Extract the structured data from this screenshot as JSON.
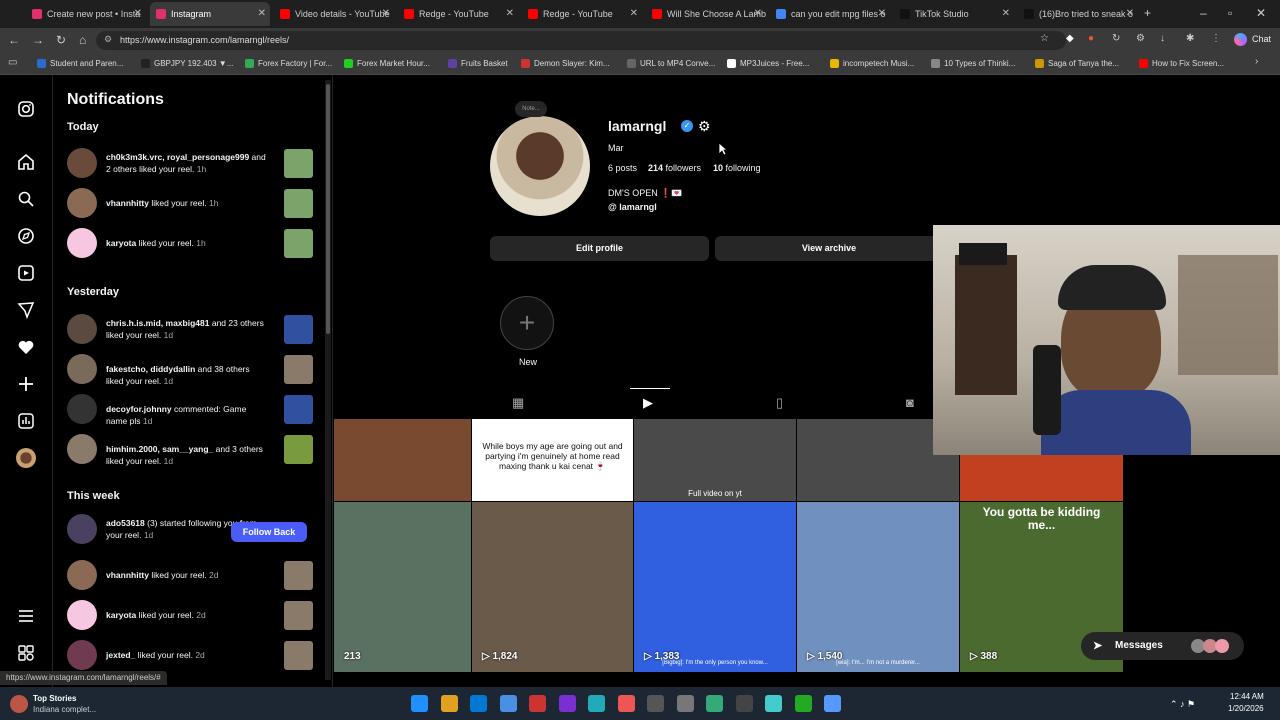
{
  "browser": {
    "tabs": [
      {
        "label": "Create new post • Insta",
        "color": "#e1306c"
      },
      {
        "label": "Instagram",
        "color": "#e1306c",
        "active": true
      },
      {
        "label": "Video details - YouTube",
        "color": "#ff0000"
      },
      {
        "label": "Redge - YouTube",
        "color": "#ff0000"
      },
      {
        "label": "Redge - YouTube",
        "color": "#ff0000"
      },
      {
        "label": "Will She Choose A Lamb",
        "color": "#ff0000"
      },
      {
        "label": "can you edit mpg files o",
        "color": "#4285f4"
      },
      {
        "label": "TikTok Studio",
        "color": "#111111"
      },
      {
        "label": "(16)Bro tried to sneak o",
        "color": "#111111"
      }
    ],
    "url": "https://www.instagram.com/lamarngl/reels/",
    "chat_label": "Chat",
    "bookmarks": [
      {
        "label": "Student and Paren...",
        "color": "#2a6bd1"
      },
      {
        "label": "GBPJPY 192.403 ▼...",
        "color": "#222"
      },
      {
        "label": "Forex Factory | For...",
        "color": "#3a5"
      },
      {
        "label": "Forex Market Hour...",
        "color": "#2c2"
      },
      {
        "label": "Fruits Basket",
        "color": "#6040a0"
      },
      {
        "label": "Demon Slayer: Kim...",
        "color": "#c33"
      },
      {
        "label": "URL to MP4 Conve...",
        "color": "#666"
      },
      {
        "label": "MP3Juices - Free...",
        "color": "#fff"
      },
      {
        "label": "incompetech Musi...",
        "color": "#e6b800"
      },
      {
        "label": "10 Types of Thinki...",
        "color": "#888"
      },
      {
        "label": "Saga of Tanya the...",
        "color": "#c90"
      },
      {
        "label": "How to Fix Screen...",
        "color": "#f00"
      }
    ]
  },
  "rail": {
    "icons": [
      "instagram-icon",
      "home-icon",
      "search-icon",
      "explore-icon",
      "reels-icon",
      "messages-icon",
      "heart-icon",
      "create-icon",
      "dashboard-icon",
      "profile-icon",
      "menu-icon",
      "threads-icon"
    ]
  },
  "notifications": {
    "title": "Notifications",
    "sections": {
      "today": "Today",
      "yesterday": "Yesterday",
      "this_week": "This week"
    },
    "items": [
      {
        "users": "ch0k3m3k.vrc, royal_personage999",
        "text": "and 2 others liked your reel.",
        "time": "1h",
        "avatar": "#6a4a3a",
        "thumb": "#7ca36a"
      },
      {
        "users": "vhannhitty",
        "text": "liked your reel.",
        "time": "1h",
        "avatar": "#8b6a55",
        "thumb": "#7ca36a"
      },
      {
        "users": "karyota",
        "text": "liked your reel.",
        "time": "1h",
        "avatar": "#f7c6e0",
        "thumb": "#7ca36a"
      },
      {
        "users": "chris.h.is.mid, maxbig481",
        "text": "and 23 others liked your reel.",
        "time": "1d",
        "avatar": "#5a4a40",
        "thumb": "#3050a0"
      },
      {
        "users": "fakestcho, diddydallin",
        "text": "and 38 others liked your reel.",
        "time": "1d",
        "avatar": "#7a6a5a",
        "thumb": "#8a7a6a"
      },
      {
        "users": "decoyfor.johnny",
        "text": "commented: Game name pls",
        "time": "1d",
        "avatar": "#333",
        "thumb": "#3050a0"
      },
      {
        "users": "himhim.2000, sam__yang_",
        "text": "and 3 others liked your reel.",
        "time": "1d",
        "avatar": "#8a7a6a",
        "thumb": "#7a9a40"
      },
      {
        "users": "ado53618",
        "text": "(3) started following you from your reel.",
        "time": "1d",
        "avatar": "#4a4060",
        "thumb": ""
      },
      {
        "users": "vhannhitty",
        "text": "liked your reel.",
        "time": "2d",
        "avatar": "#8b6a55",
        "thumb": "#8a7a6a"
      },
      {
        "users": "karyota",
        "text": "liked your reel.",
        "time": "2d",
        "avatar": "#f7c6e0",
        "thumb": "#8a7a6a"
      },
      {
        "users": "jexted_",
        "text": "liked your reel.",
        "time": "2d",
        "avatar": "#703a50",
        "thumb": "#8a7a6a"
      }
    ],
    "follow_back_label": "Follow Back"
  },
  "profile": {
    "note": "Note...",
    "username": "lamarngl",
    "name": "Mar",
    "posts": "6 posts",
    "followers_count": "214",
    "followers_label": "followers",
    "following_count": "10",
    "following_label": "following",
    "bio": "DM'S OPEN ❗💌",
    "threads": "lamarngl",
    "edit_profile": "Edit profile",
    "view_archive": "View archive",
    "new_label": "New"
  },
  "grid": [
    {
      "views": "",
      "bg": "#7a4a30",
      "caption": ""
    },
    {
      "views": "",
      "bg": "#ffffff",
      "caption": "While boys my age are going out and partying i'm genuinely at home read maxing thank u kai cenat 🍷"
    },
    {
      "views": "",
      "bg": "#4a4a4a",
      "caption": "Full video on yt"
    },
    {
      "views": "",
      "bg": "#4a4a4a",
      "caption": ""
    },
    {
      "views": "",
      "bg": "#c04020",
      "caption": ""
    },
    {
      "views": "213",
      "bg": "#5a7060",
      "caption": ""
    },
    {
      "views": "1,824",
      "bg": "#6a5a4a",
      "caption": ""
    },
    {
      "views": "1,383",
      "bg": "#3060e0",
      "caption": "[Bigbig]: I'm the only person you know..."
    },
    {
      "views": "1,540",
      "bg": "#7090c0",
      "caption": "[wia]: I'm... I'm not a murderer..."
    },
    {
      "views": "388",
      "bg": "#4a6a30",
      "caption": "You gotta be kidding me..."
    }
  ],
  "messages_label": "Messages",
  "status_url": "https://www.instagram.com/lamarngl/reels/#",
  "taskbar": {
    "top_stories": "Top Stories",
    "top_stories_sub": "Indiana complet...",
    "time": "12:44 AM",
    "date": "1/20/2026"
  }
}
